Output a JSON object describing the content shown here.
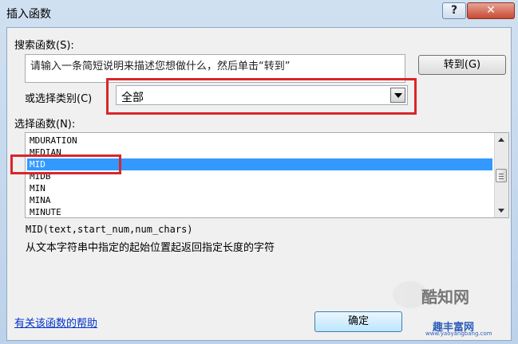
{
  "window": {
    "title": "插入函数"
  },
  "titlebar": {
    "help_glyph": "?",
    "close_glyph": "✕"
  },
  "search": {
    "label": "搜索函数(S):",
    "text": "请输入一条简短说明来描述您想做什么，然后单击“转到”",
    "go_button": "转到(G)"
  },
  "category": {
    "label": "或选择类别(C)",
    "value": "全部"
  },
  "function_list": {
    "label": "选择函数(N):",
    "items": [
      "MDURATION",
      "MEDIAN",
      "MID",
      "MIDB",
      "MIN",
      "MINA",
      "MINUTE"
    ],
    "selected": "MID"
  },
  "syntax": "MID(text,start_num,num_chars)",
  "description": "从文本字符串中指定的起始位置起返回指定长度的字符",
  "help_link": "有关该函数的帮助",
  "ok_button": "确定",
  "watermark": {
    "brand_cn": "酷知网",
    "brand2": "趣丰富网",
    "url": "www.yaoyangbang.com"
  },
  "colors": {
    "selection": "#3399ff",
    "highlight_box": "#d9262a",
    "link": "#0033cc"
  }
}
